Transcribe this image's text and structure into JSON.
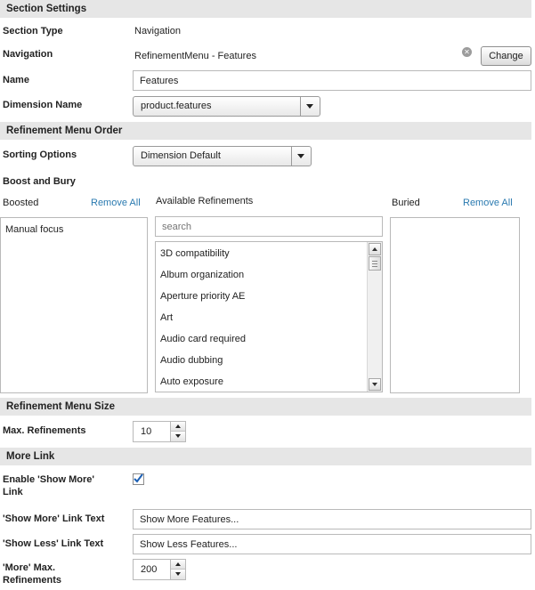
{
  "section_settings": {
    "header": "Section Settings",
    "section_type_label": "Section Type",
    "section_type_value": "Navigation",
    "navigation_label": "Navigation",
    "navigation_value": "RefinementMenu - Features",
    "change_button": "Change",
    "name_label": "Name",
    "name_value": "Features",
    "dimension_label": "Dimension Name",
    "dimension_value": "product.features"
  },
  "refinement_order": {
    "header": "Refinement Menu Order",
    "sorting_label": "Sorting Options",
    "sorting_value": "Dimension Default",
    "boost_bury_label": "Boost and Bury",
    "boosted_label": "Boosted",
    "boosted_remove_all": "Remove All",
    "boosted_items": [
      "Manual focus"
    ],
    "available_label": "Available Refinements",
    "search_placeholder": "search",
    "available_items": [
      "3D compatibility",
      "Album organization",
      "Aperture priority AE",
      "Art",
      "Audio card required",
      "Audio dubbing",
      "Auto exposure"
    ],
    "buried_label": "Buried",
    "buried_remove_all": "Remove All"
  },
  "menu_size": {
    "header": "Refinement Menu Size",
    "max_label": "Max. Refinements",
    "max_value": "10"
  },
  "more_link": {
    "header": "More Link",
    "enable_label_line1": "Enable 'Show More'",
    "enable_label_line2": "Link",
    "enable_checked": true,
    "show_more_label": "'Show More' Link Text",
    "show_more_value": "Show More Features...",
    "show_less_label": "'Show Less' Link Text",
    "show_less_value": "Show Less Features...",
    "more_max_label_line1": "'More' Max.",
    "more_max_label_line2": "Refinements",
    "more_max_value": "200"
  },
  "icons": {
    "clear": "clear-icon",
    "dropdown": "chevron-down-icon",
    "check": "checkmark-icon"
  },
  "colors": {
    "link": "#2a7ab0",
    "section_header_bg": "#e6e6e6",
    "check": "#1a5fb4"
  }
}
